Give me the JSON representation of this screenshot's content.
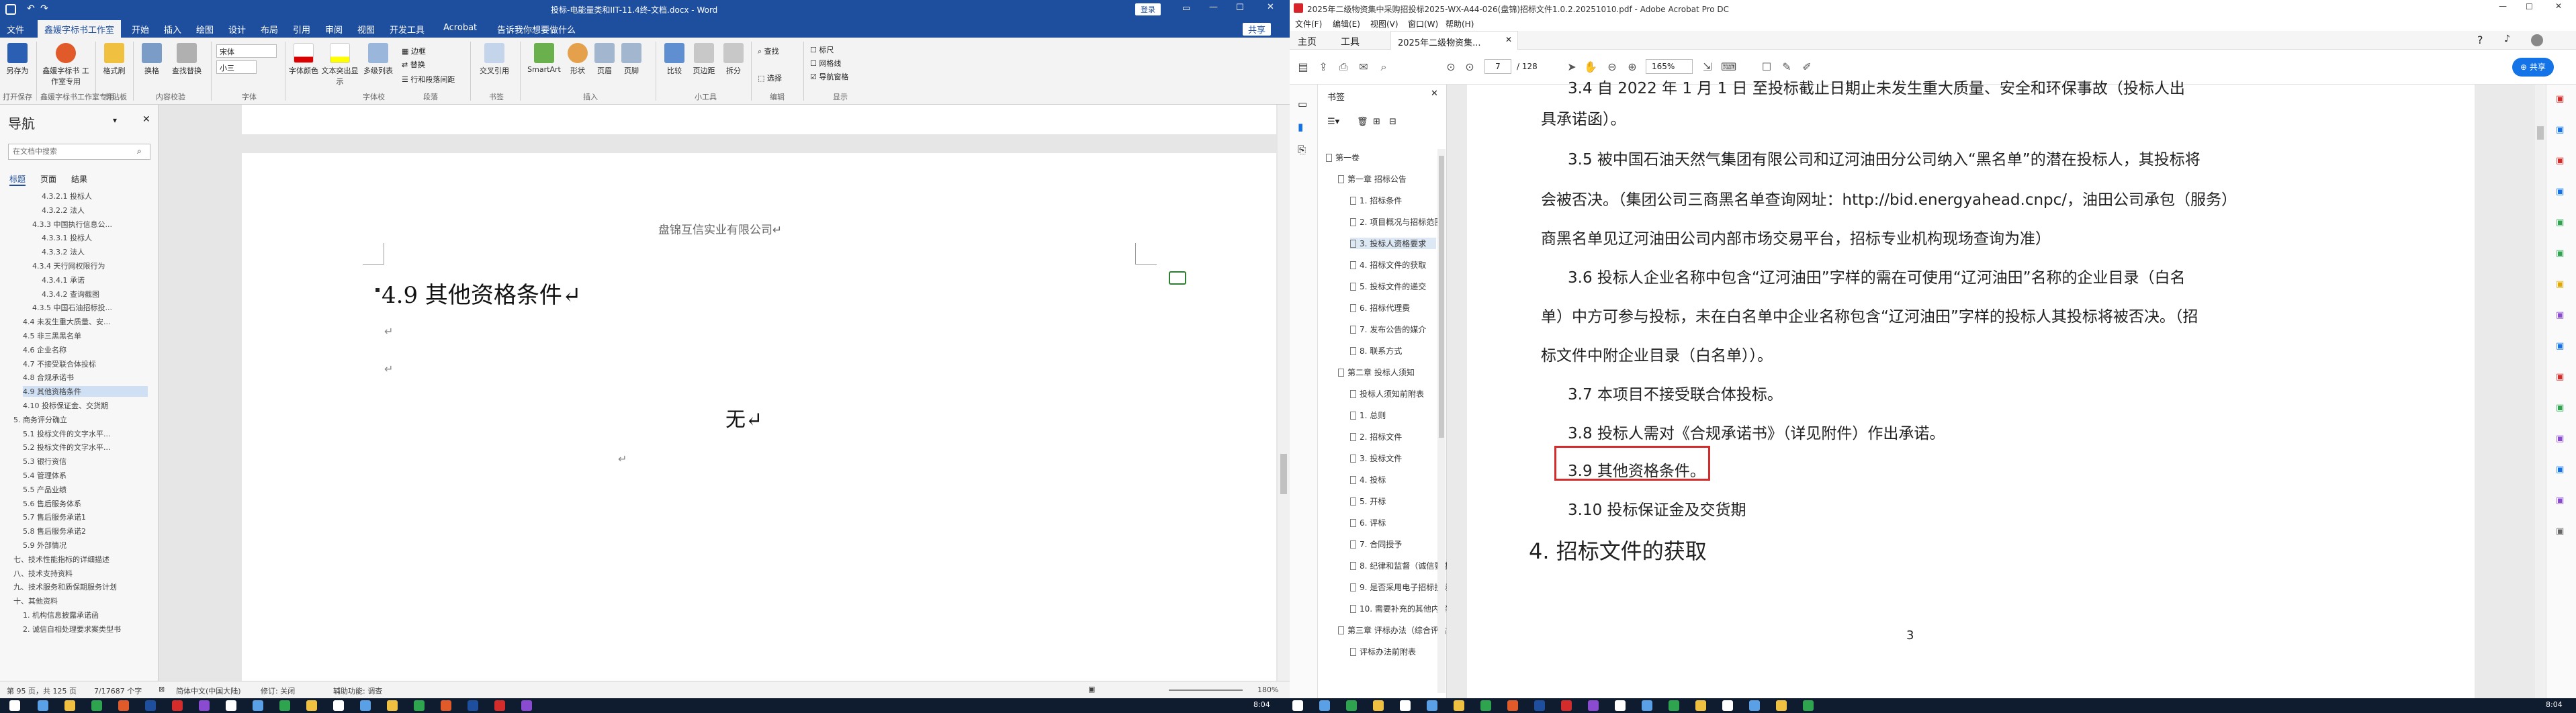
{
  "word": {
    "title": "投标-电能量类和IIT-11.4终-文档.docx - Word",
    "title_btn": "登录",
    "share": "共享",
    "tabs": [
      "文件",
      "鑫媛字标书工作室",
      "开始",
      "插入",
      "绘图",
      "设计",
      "布局",
      "引用",
      "审阅",
      "视图",
      "开发工具",
      "Acrobat",
      "告诉我你想要做什么"
    ],
    "ribbon": {
      "buttons": [
        "另存为",
        "鑫媛字标书\n工作室专用",
        "格式刷",
        "换格",
        "查找替换",
        "字体颜色",
        "文本突出显示",
        "多级列表",
        "交叉引用",
        "SmartArt",
        "形状",
        "页眉",
        "页脚",
        "比较",
        "页边距",
        "拆分",
        "导航窗格"
      ],
      "font_name": "宋体",
      "font_size": "小三",
      "border_label": "边框",
      "replace_label": "替换",
      "select_label": "选择",
      "find_label": "查找",
      "line_spacing_label": "行和段落间距",
      "check_ruler": "标尺",
      "check_grid": "网格线",
      "check_nav": "导航窗格",
      "groups": [
        "打开保存",
        "鑫媛字标书工作室专用",
        "剪贴板",
        "内容校验",
        "字体",
        "字体校",
        "段落",
        "书签",
        "插入",
        "小工具",
        "编辑",
        "显示"
      ]
    },
    "nav": {
      "title": "导航",
      "search_placeholder": "在文档中搜索",
      "tabs": [
        "标题",
        "页面",
        "结果"
      ],
      "items": [
        "4.3.2.1 投标人",
        "4.3.2.2 法人",
        "4.3.3 中国执行信息公...",
        "4.3.3.1 投标人",
        "4.3.3.2 法人",
        "4.3.4 天行网权限行为",
        "4.3.4.1 承诺",
        "4.3.4.2 查询截图",
        "4.3.5 中国石油招标投...",
        "4.4 未发生重大质量、安...",
        "4.5 非三黑黑名单",
        "4.6 企业名称",
        "4.7 不接受联合体投标",
        "4.8 合规承诺书",
        "4.9 其他资格条件",
        "4.10 投标保证金、交货期",
        "5. 商务评分确立",
        "5.1 投标文件的文字水平...",
        "5.2 投标文件的文字水平...",
        "5.3 银行资信",
        "5.4 管理体系",
        "5.5 产品业绩",
        "5.6 售后服务体系",
        "5.7 售后服务承诺1",
        "5.8 售后服务承诺2",
        "5.9 外部情况",
        "七、技术性能指标的详细描述",
        "八、技术支持资料",
        "九、技术服务和质保期服务计划",
        "十、其他资料",
        "1. 机构信息披露承诺函",
        "2. 诚信自相处理要求案类型书"
      ]
    },
    "page": {
      "header": "盘锦互信实业有限公司↵",
      "heading": "4.9  其他资格条件↵",
      "empty1": "↵",
      "empty2": "↵",
      "body": "无↵",
      "empty3": "↵"
    },
    "status": {
      "page": "第 95 页，共 125 页",
      "words": "7/17687 个字",
      "lang": "简体中文(中国大陆)",
      "track": "修订: 关闭",
      "access": "辅助功能: 调查",
      "zoom": "180%"
    }
  },
  "pdf": {
    "title": "2025年二级物资集中采购招投标2025-WX-A44-026(盘锦)招标文件1.0.2.20251010.pdf - Adobe Acrobat Pro DC",
    "menu": [
      "文件(F)",
      "编辑(E)",
      "视图(V)",
      "窗口(W)",
      "帮助(H)"
    ],
    "tabs": [
      "主页",
      "工具",
      "2025年二级物资集..."
    ],
    "page_num": "7",
    "page_total": "/ 128",
    "zoom": "165%",
    "share": "共享",
    "bookmarks_title": "书签",
    "bookmarks": [
      {
        "label": "第一卷",
        "indent": 0
      },
      {
        "label": "第一章  招标公告",
        "indent": 1
      },
      {
        "label": "1. 招标条件",
        "indent": 2
      },
      {
        "label": "2. 项目概况与招标范围",
        "indent": 2
      },
      {
        "label": "3. 投标人资格要求",
        "indent": 2
      },
      {
        "label": "4. 招标文件的获取",
        "indent": 2
      },
      {
        "label": "5. 投标文件的递交",
        "indent": 2
      },
      {
        "label": "6. 招标代理费",
        "indent": 2
      },
      {
        "label": "7. 发布公告的媒介",
        "indent": 2
      },
      {
        "label": "8. 联系方式",
        "indent": 2
      },
      {
        "label": "第二章  投标人须知",
        "indent": 1
      },
      {
        "label": "投标人须知前附表",
        "indent": 2
      },
      {
        "label": "1. 总则",
        "indent": 2
      },
      {
        "label": "2. 招标文件",
        "indent": 2
      },
      {
        "label": "3. 投标文件",
        "indent": 2
      },
      {
        "label": "4. 投标",
        "indent": 2
      },
      {
        "label": "5. 开标",
        "indent": 2
      },
      {
        "label": "6. 评标",
        "indent": 2
      },
      {
        "label": "7. 合同授予",
        "indent": 2
      },
      {
        "label": "8. 纪律和监督（诚信要求）",
        "indent": 2
      },
      {
        "label": "9. 是否采用电子招标投标",
        "indent": 2
      },
      {
        "label": "10. 需要补充的其他内容",
        "indent": 2
      },
      {
        "label": "第三章  评标办法（综合评估法）",
        "indent": 1
      },
      {
        "label": "评标办法前附表",
        "indent": 2
      }
    ],
    "content": {
      "l0": "3.4 自 2022 年 1 月 1 日 至投标截止日期止未发生重大质量、安全和环保事故（投标人出",
      "l1": "具承诺函）。",
      "l2": "3.5 被中国石油天然气集团有限公司和辽河油田分公司纳入“黑名单”的潜在投标人，其投标将",
      "l3": "会被否决。（集团公司三商黑名单查询网址：http://bid.energyahead.cnpc/，油田公司承包（服务）",
      "l4": "商黑名单见辽河油田公司内部市场交易平台，招标专业机构现场查询为准）",
      "l5": "3.6 投标人企业名称中包含“辽河油田”字样的需在可使用“辽河油田”名称的企业目录（白名",
      "l6": "单）中方可参与投标，未在白名单中企业名称包含“辽河油田”字样的投标人其投标将被否决。（招",
      "l7": "标文件中附企业目录（白名单））。",
      "l8": "3.7 本项目不接受联合体投标。",
      "l9": "3.8 投标人需对《合规承诺书》（详见附件）作出承诺。",
      "l10": "3.9 其他资格条件。",
      "l11": "3.10 投标保证金及交货期",
      "h4": "4. 招标文件的获取",
      "pagenum": "3"
    }
  },
  "taskbar": {
    "time": "8:04",
    "time2": "8:04"
  },
  "colors": {
    "word_blue": "#1e4e9e",
    "highlight_red": "#d42b2b",
    "acrobat_blue": "#1473e6"
  }
}
